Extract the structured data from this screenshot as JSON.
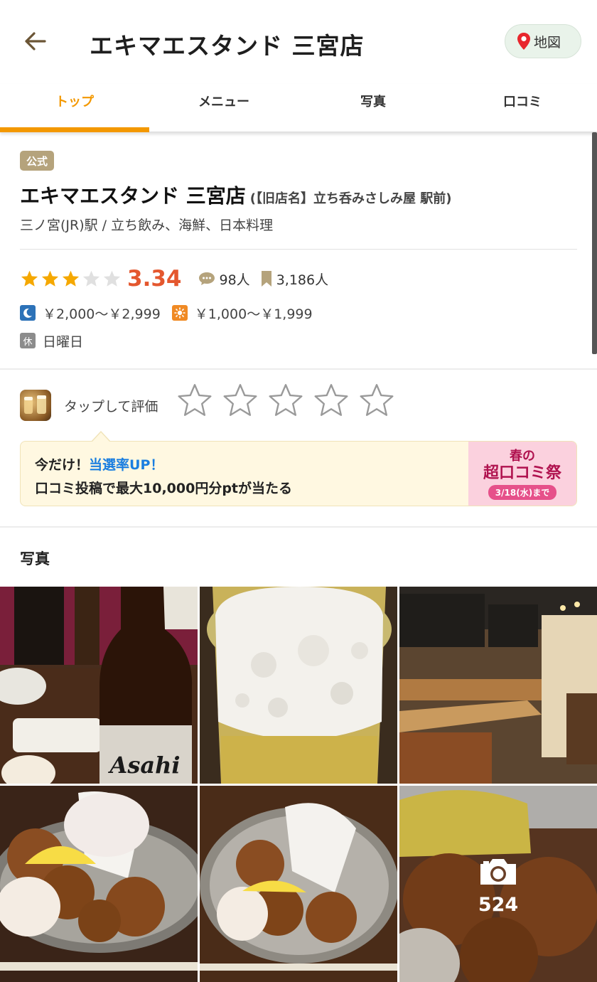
{
  "header": {
    "title": "エキマエスタンド 三宮店",
    "map_label": "地図"
  },
  "tabs": [
    {
      "label": "トップ",
      "active": true
    },
    {
      "label": "メニュー",
      "active": false
    },
    {
      "label": "写真",
      "active": false
    },
    {
      "label": "口コミ",
      "active": false
    }
  ],
  "shop": {
    "badge": "公式",
    "name": "エキマエスタンド 三宮店",
    "old_name": "(【旧店名】立ち呑みさしみ屋 駅前)",
    "genre": "三ノ宮(JR)駅 / 立ち飲み、海鮮、日本料理",
    "rating": "3.34",
    "stars_filled": 3,
    "reviews": "98人",
    "saves": "3,186人",
    "dinner_price": "￥2,000～￥2,999",
    "lunch_price": "￥1,000～￥1,999",
    "closed_icon": "休",
    "closed": "日曜日"
  },
  "rate": {
    "label": "タップして評価",
    "star_count": 5
  },
  "banner": {
    "line1_prefix": "今だけ！",
    "line1_highlight": "当選率UP！",
    "line2": "口コミ投稿で最大10,000円分ptが当たる",
    "campaign_line1": "春の",
    "campaign_line2": "超口コミ祭",
    "campaign_date": "3/18(水)まで"
  },
  "photos": {
    "title": "写真",
    "count": "524",
    "items": [
      "beer-bottle-photo",
      "beer-glass-photo",
      "interior-photo",
      "karaage-photo-1",
      "karaage-photo-2",
      "karaage-closeup-photo"
    ]
  },
  "colors": {
    "accent": "#f39800",
    "score": "#e4572e",
    "badge": "#b5a37c",
    "highlight": "#1a7ee0"
  }
}
